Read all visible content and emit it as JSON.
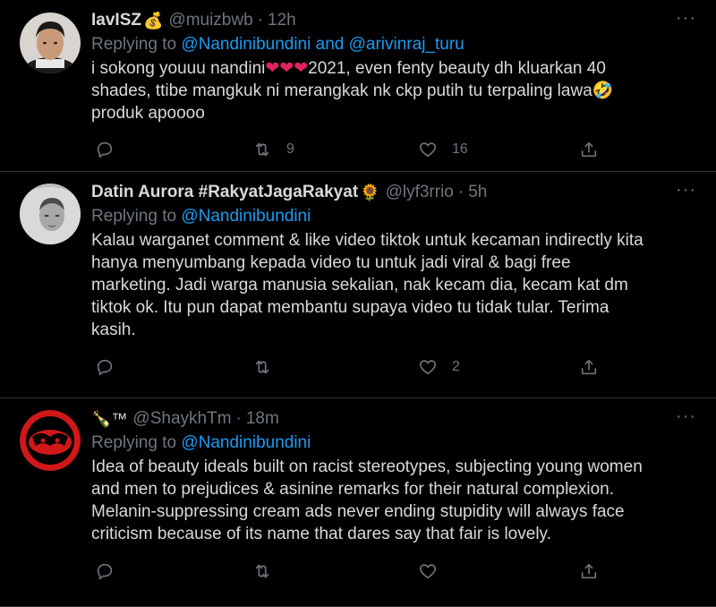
{
  "tweets": [
    {
      "display_name": "IavISZ",
      "name_emoji": "💰",
      "handle": "@muizbwb",
      "time": "12h",
      "replying_label": "Replying to ",
      "replying_mentions": [
        "@Nandinibundini",
        " and ",
        "@arivinraj_turu"
      ],
      "text_parts": [
        "i sokong youuu nandini",
        "❤❤❤",
        "2021, even fenty beauty dh kluarkan 40\nshades, ttibe mangkuk ni merangkak nk ckp putih tu terpaling lawa",
        "🤣",
        "\nproduk apoooo"
      ],
      "retweets": "9",
      "likes": "16"
    },
    {
      "display_name": "Datin Aurora #RakyatJagaRakyat",
      "name_emoji": "🌻",
      "handle": "@lyf3rrio",
      "time": "5h",
      "replying_label": "Replying to ",
      "replying_mentions": [
        "@Nandinibundini"
      ],
      "text": "Kalau warganet comment & like video tiktok untuk kecaman indirectly kita\nhanya menyumbang kepada video tu untuk jadi viral & bagi free\nmarketing. Jadi warga manusia sekalian, nak kecam dia, kecam kat dm\ntiktok ok. Itu pun dapat membantu supaya video tu tidak tular. Terima\nkasih.",
      "retweets": "",
      "likes": "2"
    },
    {
      "display_name": "",
      "name_emoji": "🍾™",
      "handle": "@ShaykhTm",
      "time": "18m",
      "replying_label": "Replying to ",
      "replying_mentions": [
        "@Nandinibundini"
      ],
      "text": "Idea of beauty ideals built on racist stereotypes, subjecting young women\nand men to prejudices & asinine remarks for their natural complexion.\nMelanin-suppressing cream ads never ending stupidity will always face\ncriticism because of its name that dares say that fair is lovely.",
      "retweets": "",
      "likes": ""
    }
  ],
  "ui": {
    "dot": "·",
    "more": "···"
  },
  "colors": {
    "background": "#000000",
    "link": "#1d9bf0",
    "muted": "#6e767d",
    "heart": "#e0245e"
  }
}
